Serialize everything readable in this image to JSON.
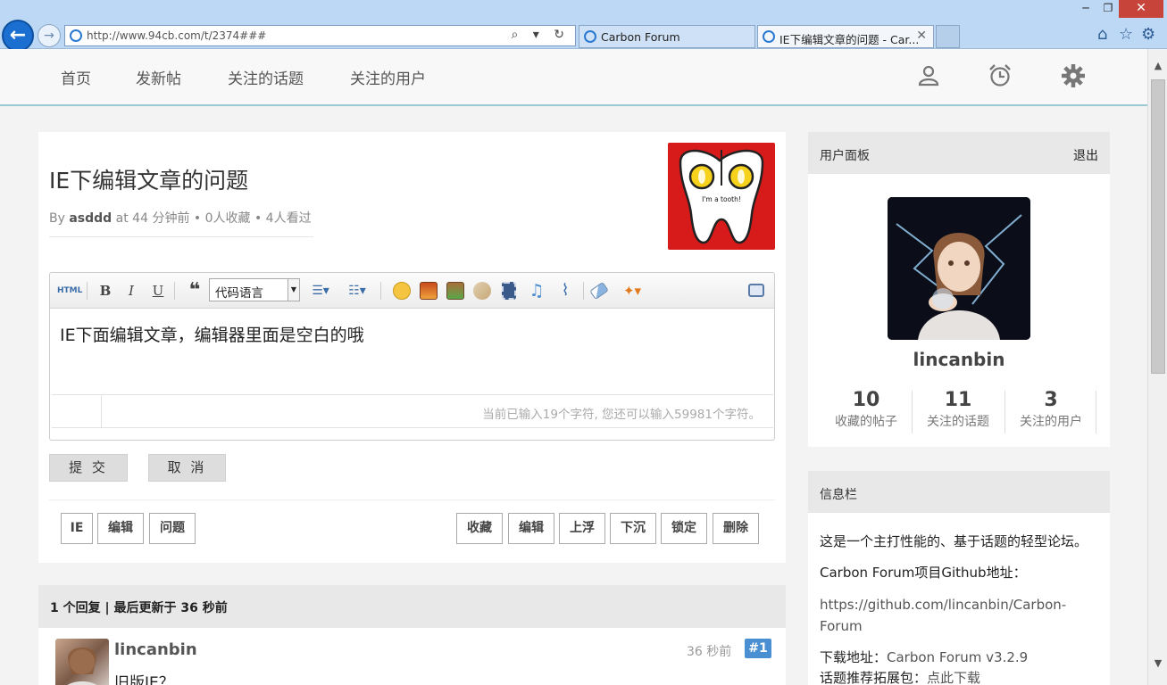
{
  "browser": {
    "url": "http://www.94cb.com/t/2374###",
    "tabs": [
      {
        "label": "Carbon Forum"
      },
      {
        "label": "IE下编辑文章的问题 - Car..."
      }
    ],
    "url_icons": "⌕ ▾ ↻",
    "window": {
      "minimize": "─",
      "restore": "❐",
      "close": "✕"
    }
  },
  "nav": {
    "items": [
      "首页",
      "发新帖",
      "关注的话题",
      "关注的用户"
    ]
  },
  "post": {
    "title": "IE下编辑文章的问题",
    "meta_by": "By",
    "author": "asddd",
    "meta_rest": "at 44 分钟前 • 0人收藏 • 4人看过",
    "avatar_caption": "I'm a tooth!"
  },
  "editor": {
    "language_select": "代码语言",
    "content": "IE下面编辑文章，编辑器里面是空白的哦",
    "char_count": "当前已输入19个字符, 您还可以输入59981个字符。",
    "toolbar_labels": {
      "html": "HTML",
      "bold": "B",
      "italic": "I",
      "underline": "U",
      "quote": "❝"
    }
  },
  "actions": {
    "submit": "提 交",
    "cancel": "取 消"
  },
  "tags": [
    "IE",
    "编辑",
    "问题"
  ],
  "manage": [
    "收藏",
    "编辑",
    "上浮",
    "下沉",
    "锁定",
    "删除"
  ],
  "replies": {
    "header": "1 个回复 | 最后更新于 36 秒前",
    "items": [
      {
        "user": "lincanbin",
        "time": "36 秒前",
        "num": "#1",
        "text": "旧版IE？"
      }
    ]
  },
  "user_panel": {
    "title": "用户面板",
    "logout": "退出",
    "username": "lincanbin",
    "stats": [
      {
        "num": "10",
        "label": "收藏的帖子"
      },
      {
        "num": "11",
        "label": "关注的话题"
      },
      {
        "num": "3",
        "label": "关注的用户"
      }
    ]
  },
  "info_panel": {
    "title": "信息栏",
    "desc": "这是一个主打性能的、基于话题的轻型论坛。",
    "github_label": "Carbon Forum项目Github地址：",
    "github_url": "https://github.com/lincanbin/Carbon-Forum",
    "download_label": "下载地址：",
    "download_value": "Carbon Forum v3.2.9",
    "pack_label": "话题推荐拓展包：",
    "pack_value": "点此下载"
  },
  "colors": {
    "accent": "#4a8fd1",
    "nav_border": "#9cc8d6",
    "avatar_red": "#d71a1a"
  }
}
